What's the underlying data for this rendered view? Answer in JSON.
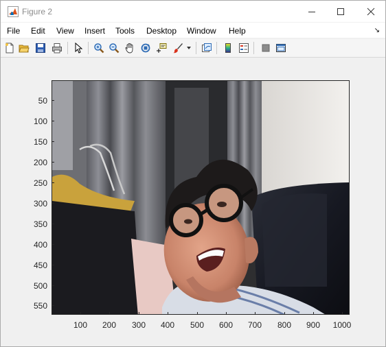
{
  "window": {
    "title": "Figure 2"
  },
  "menu": {
    "items": [
      "File",
      "Edit",
      "View",
      "Insert",
      "Tools",
      "Desktop",
      "Window",
      "Help"
    ]
  },
  "toolbar": {
    "buttons": [
      "new-figure-icon",
      "open-file-icon",
      "save-icon",
      "print-icon",
      "edit-plot-arrow-icon",
      "zoom-in-icon",
      "zoom-out-icon",
      "pan-hand-icon",
      "rotate-3d-icon",
      "data-cursor-icon",
      "brush-icon",
      "link-plot-icon",
      "colorbar-icon",
      "legend-icon",
      "hide-plot-tools-icon",
      "show-plot-tools-icon"
    ]
  },
  "axes": {
    "content": "webcam image",
    "yticks": [
      "50",
      "100",
      "150",
      "200",
      "250",
      "300",
      "350",
      "400",
      "450",
      "500",
      "550"
    ],
    "xticks": [
      "100",
      "200",
      "300",
      "400",
      "500",
      "600",
      "700",
      "800",
      "900",
      "1000"
    ],
    "xlim": [
      0.5,
      1024.5
    ],
    "ylim": [
      0.5,
      576.5
    ]
  }
}
